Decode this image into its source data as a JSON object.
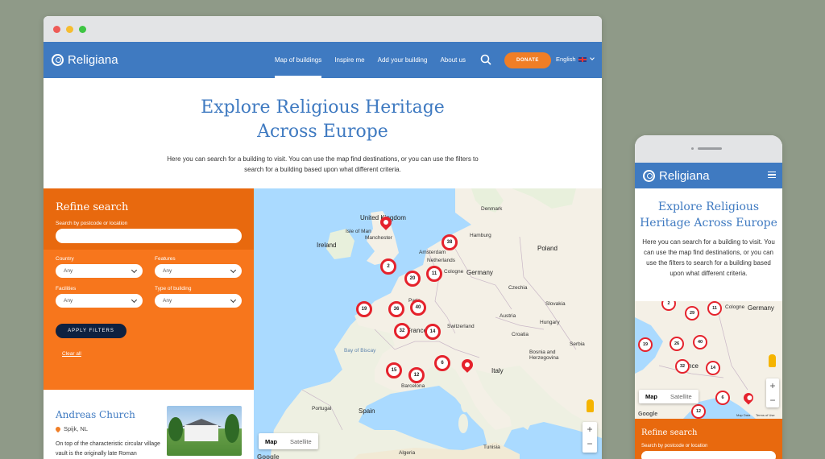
{
  "brand": "Religiana",
  "nav": {
    "links": [
      "Map of buildings",
      "Inspire me",
      "Add your building",
      "About us"
    ],
    "donate": "DONATE",
    "language": "English"
  },
  "hero": {
    "title": "Explore Religious Heritage Across Europe",
    "text": "Here you can search for a building to visit. You can use the map find destinations, or you can use the filters to search for a building based upon what different criteria."
  },
  "refine": {
    "title": "Refine search",
    "search_label": "Search by postcode or location",
    "filters": [
      {
        "label": "Country",
        "value": "Any"
      },
      {
        "label": "Features",
        "value": "Any"
      },
      {
        "label": "Facilities",
        "value": "Any"
      },
      {
        "label": "Type of building",
        "value": "Any"
      }
    ],
    "apply": "APPLY FILTERS",
    "clear": "Clear all"
  },
  "result": {
    "title": "Andreas Church",
    "location": "Spijk, NL",
    "description": "On top of the characteristic circular village vault is the originally late Roman"
  },
  "map": {
    "toggle": [
      "Map",
      "Satellite"
    ],
    "zoom_in": "+",
    "zoom_out": "−",
    "google": "Google",
    "labels": [
      "United Kingdom",
      "Isle of Man",
      "Manchester",
      "Ireland",
      "Denmark",
      "Hamburg",
      "Poland",
      "Amsterdam",
      "Netherlands",
      "Germany",
      "Cologne",
      "Czechia",
      "Slovakia",
      "Paris",
      "Switzerland",
      "Austria",
      "Hungary",
      "France",
      "Croatia",
      "Bosnia and Herzegovina",
      "Serbia",
      "Italy",
      "Barcelona",
      "Portugal",
      "Spain",
      "Bay of Biscay",
      "Tunisia",
      "Algeria"
    ],
    "clusters": [
      "38",
      "2",
      "20",
      "11",
      "19",
      "36",
      "40",
      "32",
      "14",
      "6",
      "15",
      "12"
    ]
  },
  "mobile": {
    "hero_title": "Explore Religious Heritage Across Europe",
    "hero_text": "Here you can search for a building to visit. You can use the map find destinations, or you can use the filters to search for a building based upon what different criteria.",
    "clusters": [
      "2",
      "29",
      "11",
      "19",
      "26",
      "40",
      "32",
      "14",
      "6",
      "12"
    ],
    "map_labels": [
      "Germany",
      "Cologne",
      "France"
    ],
    "refine_title": "Refine search",
    "search_label": "Search by postcode or location",
    "map_data": "Map Data",
    "terms": "Terms of Use"
  },
  "colors": {
    "primary": "#3f7ac1",
    "accent": "#f07e26",
    "refine": "#f7761c",
    "marker": "#e5222c"
  }
}
